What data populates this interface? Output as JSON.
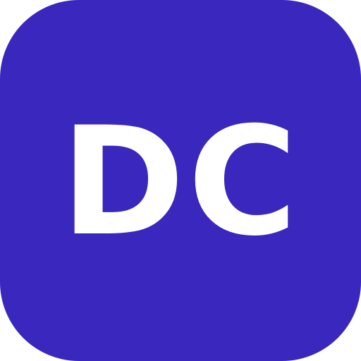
{
  "icon": {
    "monogram": "DC",
    "background_color": "#3A27BE",
    "text_color": "#FFFFFF"
  }
}
